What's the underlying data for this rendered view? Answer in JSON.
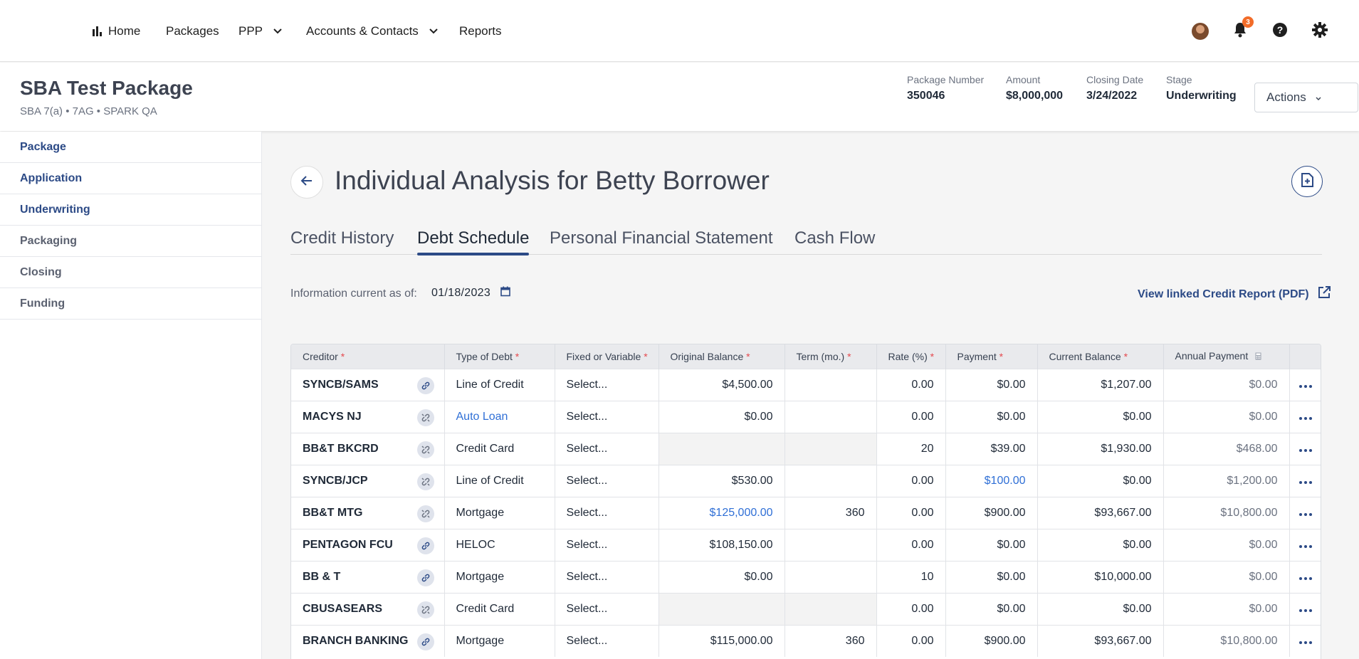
{
  "nav": {
    "items": [
      "Home",
      "Packages",
      "PPP",
      "Accounts & Contacts",
      "Reports"
    ],
    "notification_count": "3"
  },
  "package": {
    "title": "SBA Test Package",
    "subtitle": "SBA 7(a) • 7AG • SPARK QA",
    "stats": [
      {
        "label": "Package Number",
        "value": "350046"
      },
      {
        "label": "Amount",
        "value": "$8,000,000"
      },
      {
        "label": "Closing Date",
        "value": "3/24/2022"
      },
      {
        "label": "Stage",
        "value": "Underwriting"
      }
    ],
    "actions_label": "Actions"
  },
  "sidebar": {
    "items": [
      "Package",
      "Application",
      "Underwriting",
      "Packaging",
      "Closing",
      "Funding"
    ]
  },
  "main": {
    "title": "Individual Analysis for Betty Borrower",
    "tabs": [
      "Credit History",
      "Debt Schedule",
      "Personal Financial Statement",
      "Cash Flow"
    ],
    "active_tab": "Debt Schedule",
    "info_label": "Information current as of:",
    "info_date": "01/18/2023",
    "linked_report": "View linked Credit Report (PDF)"
  },
  "table": {
    "headers": [
      "Creditor",
      "Type of Debt",
      "Fixed or Variable",
      "Original Balance",
      "Term (mo.)",
      "Rate (%)",
      "Payment",
      "Current Balance",
      "Annual Payment"
    ],
    "rows": [
      {
        "creditor": "SYNCB/SAMS",
        "type": "Line of Credit",
        "fixed": "Select...",
        "orig": "$4,500.00",
        "term": "",
        "rate": "0.00",
        "payment": "$0.00",
        "current": "$1,207.00",
        "annual": "$0.00"
      },
      {
        "creditor": "MACYS NJ",
        "type": "Auto Loan",
        "fixed": "Select...",
        "orig": "$0.00",
        "term": "",
        "rate": "0.00",
        "payment": "$0.00",
        "current": "$0.00",
        "annual": "$0.00"
      },
      {
        "creditor": "BB&T BKCRD",
        "type": "Credit Card",
        "fixed": "Select...",
        "orig": "",
        "term": "",
        "rate": "20",
        "payment": "$39.00",
        "current": "$1,930.00",
        "annual": "$468.00"
      },
      {
        "creditor": "SYNCB/JCP",
        "type": "Line of Credit",
        "fixed": "Select...",
        "orig": "$530.00",
        "term": "",
        "rate": "0.00",
        "payment": "$100.00",
        "current": "$0.00",
        "annual": "$1,200.00"
      },
      {
        "creditor": "BB&T MTG",
        "type": "Mortgage",
        "fixed": "Select...",
        "orig": "$125,000.00",
        "term": "360",
        "rate": "0.00",
        "payment": "$900.00",
        "current": "$93,667.00",
        "annual": "$10,800.00"
      },
      {
        "creditor": "PENTAGON FCU",
        "type": "HELOC",
        "fixed": "Select...",
        "orig": "$108,150.00",
        "term": "",
        "rate": "0.00",
        "payment": "$0.00",
        "current": "$0.00",
        "annual": "$0.00"
      },
      {
        "creditor": "BB & T",
        "type": "Mortgage",
        "fixed": "Select...",
        "orig": "$0.00",
        "term": "",
        "rate": "10",
        "payment": "$0.00",
        "current": "$10,000.00",
        "annual": "$0.00"
      },
      {
        "creditor": "CBUSASEARS",
        "type": "Credit Card",
        "fixed": "Select...",
        "orig": "",
        "term": "",
        "rate": "0.00",
        "payment": "$0.00",
        "current": "$0.00",
        "annual": "$0.00"
      },
      {
        "creditor": "BRANCH BANKING & TRUST",
        "type": "Mortgage",
        "fixed": "Select...",
        "orig": "$115,000.00",
        "term": "360",
        "rate": "0.00",
        "payment": "$900.00",
        "current": "$93,667.00",
        "annual": "$10,800.00"
      }
    ]
  },
  "colors": {
    "primary": "#2c4a86",
    "link": "#2f6fd6",
    "required": "#e5484d",
    "badge": "#f26c29"
  }
}
